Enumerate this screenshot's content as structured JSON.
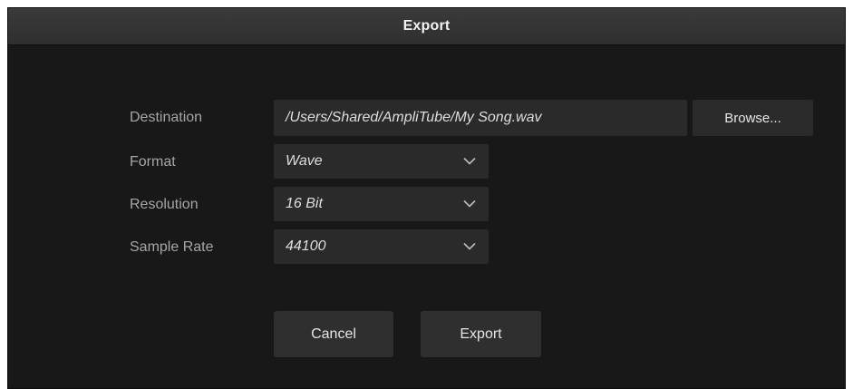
{
  "dialog": {
    "title": "Export"
  },
  "form": {
    "destination": {
      "label": "Destination",
      "value": "/Users/Shared/AmpliTube/My Song.wav",
      "browse_label": "Browse..."
    },
    "format": {
      "label": "Format",
      "value": "Wave"
    },
    "resolution": {
      "label": "Resolution",
      "value": "16 Bit"
    },
    "sample_rate": {
      "label": "Sample Rate",
      "value": "44100"
    }
  },
  "actions": {
    "cancel_label": "Cancel",
    "export_label": "Export"
  },
  "icons": {
    "dropdown": "chevron-down-icon"
  },
  "colors": {
    "background": "#181818",
    "titlebar": "#333333",
    "field": "#2a2a2a",
    "button": "#2f2f2f",
    "label_text": "#a6a6a6",
    "value_text": "#dedede"
  }
}
